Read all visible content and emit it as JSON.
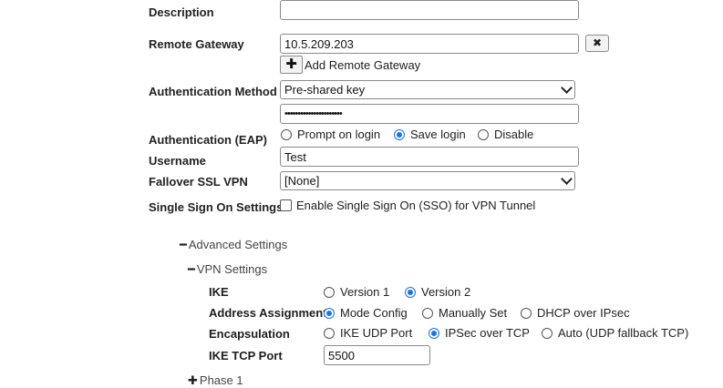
{
  "form": {
    "description": {
      "label": "Description",
      "value": ""
    },
    "remote_gateway": {
      "label": "Remote Gateway",
      "value": "10.5.209.203",
      "remove_glyph": "✖",
      "add_glyph": "✚",
      "add_label": "Add Remote Gateway"
    },
    "auth_method": {
      "label": "Authentication Method",
      "selected": "Pre-shared key",
      "psk_masked": "••••••••••••••••••••••"
    },
    "auth_eap": {
      "label": "Authentication (EAP)",
      "options": [
        "Prompt on login",
        "Save login",
        "Disable"
      ],
      "selected_index": 1
    },
    "username": {
      "label": "Username",
      "value": "Test"
    },
    "fallback_ssl_vpn": {
      "label": "Fallover SSL VPN",
      "selected": "[None]"
    },
    "sso": {
      "label": "Single Sign On Settings",
      "checkbox_label": "Enable Single Sign On (SSO) for VPN Tunnel",
      "checked": false
    }
  },
  "advanced": {
    "toggle_symbol": "━",
    "title": "Advanced Settings",
    "vpn_settings": {
      "toggle_symbol": "━",
      "title": "VPN Settings",
      "ike": {
        "label": "IKE",
        "options": [
          "Version 1",
          "Version 2"
        ],
        "selected_index": 1
      },
      "address_assignment": {
        "label": "Address Assignment",
        "options": [
          "Mode Config",
          "Manually Set",
          "DHCP over IPsec"
        ],
        "selected_index": 0
      },
      "encapsulation": {
        "label": "Encapsulation",
        "options": [
          "IKE UDP Port",
          "IPSec over TCP",
          "Auto (UDP fallback TCP)"
        ],
        "selected_index": 1
      },
      "ike_tcp_port": {
        "label": "IKE TCP Port",
        "value": "5500"
      }
    },
    "phase1": {
      "toggle_symbol": "✚",
      "title": "Phase 1"
    }
  },
  "colors": {
    "accent": "#1a73e8",
    "border": "#8a8a8a",
    "label": "#222222"
  }
}
